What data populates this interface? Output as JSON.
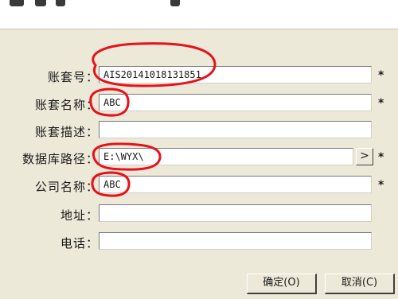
{
  "form": {
    "account_no": {
      "label": "账套号：",
      "value": "AIS20141018131851",
      "required": "*"
    },
    "account_name": {
      "label": "账套名称：",
      "value": "ABC",
      "required": "*"
    },
    "account_desc": {
      "label": "账套描述：",
      "value": ""
    },
    "db_path": {
      "label": "数据库路径：",
      "value": "E:\\WYX\\",
      "browse": ">",
      "required": "*"
    },
    "company_name": {
      "label": "公司名称：",
      "value": "ABC",
      "required": "*"
    },
    "address": {
      "label": "地址：",
      "value": ""
    },
    "phone": {
      "label": "电话：",
      "value": ""
    }
  },
  "buttons": {
    "ok": "确定(O)",
    "cancel": "取消(C)"
  },
  "annotation_color": "#e8111b"
}
